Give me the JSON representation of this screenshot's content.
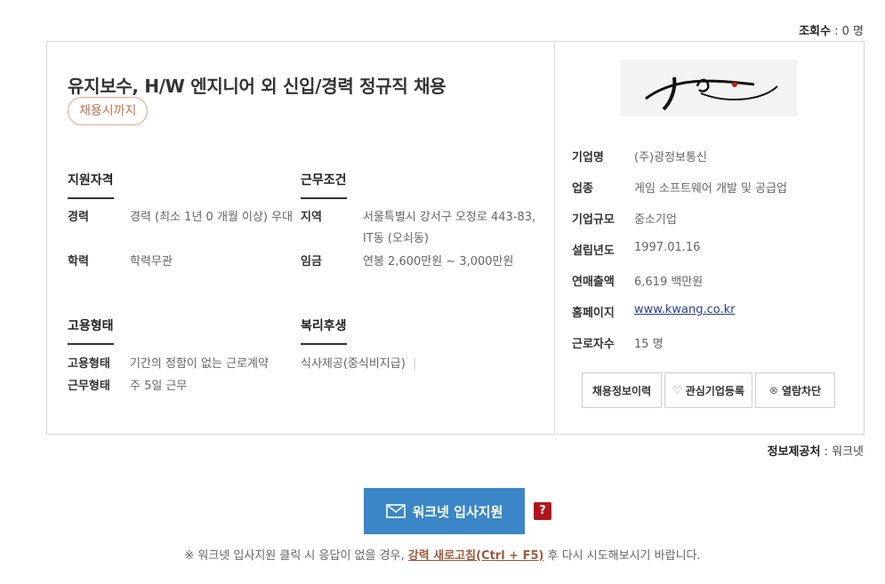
{
  "views": {
    "label": "조회수",
    "value": "0 명"
  },
  "job": {
    "title": "유지보수, H/W 엔지니어 외 신입/경력 정규직 채용",
    "deadline_badge": "채용시까지"
  },
  "qualification": {
    "heading": "지원자격",
    "rows": [
      {
        "key": "경력",
        "value": "경력 (최소 1년 0 개월 이상) 우대"
      },
      {
        "key": "학력",
        "value": "학력무관"
      }
    ]
  },
  "conditions": {
    "heading": "근무조건",
    "rows": [
      {
        "key": "지역",
        "value": "서울특별시 강서구 오정로 443-83, IT동 (오쇠동)"
      },
      {
        "key": "임금",
        "value": "연봉 2,600만원 ~ 3,000만원"
      }
    ]
  },
  "employment": {
    "heading": "고용형태",
    "rows": [
      {
        "key": "고용형태",
        "value": "기간의 정함이 없는 근로계약"
      },
      {
        "key": "근무형태",
        "value": "주 5일 근무"
      }
    ]
  },
  "welfare": {
    "heading": "복리후생",
    "value": "식사제공(중식비지급)"
  },
  "company": {
    "rows": [
      {
        "key": "기업명",
        "value": "(주)광정보통신"
      },
      {
        "key": "업종",
        "value": "게임 소프트웨어 개발 및 공급업"
      },
      {
        "key": "기업규모",
        "value": "중소기업"
      },
      {
        "key": "설립년도",
        "value": "1997.01.16"
      },
      {
        "key": "연매출액",
        "value": "6,619 백만원"
      },
      {
        "key": "홈페이지",
        "value": "www.kwang.co.kr"
      },
      {
        "key": "근로자수",
        "value": "15 명"
      }
    ],
    "buttons": {
      "history": "채용정보이력",
      "favorite": "관심기업등록",
      "block": "열람차단"
    }
  },
  "provider": {
    "label": "정보제공처",
    "value": "워크넷"
  },
  "apply": {
    "label": "워크넷 입사지원",
    "help": "?"
  },
  "notice": {
    "before": "※ 워크넷 입사지원 클릭 시 응답이 없을 경우,",
    "link": "강력 새로고침(Ctrl + F5)",
    "after": "후 다시 시도해보시기 바랍니다."
  },
  "colors": {
    "accent": "#3a86c6",
    "badge": "#c0714f",
    "help": "#b3141c"
  }
}
